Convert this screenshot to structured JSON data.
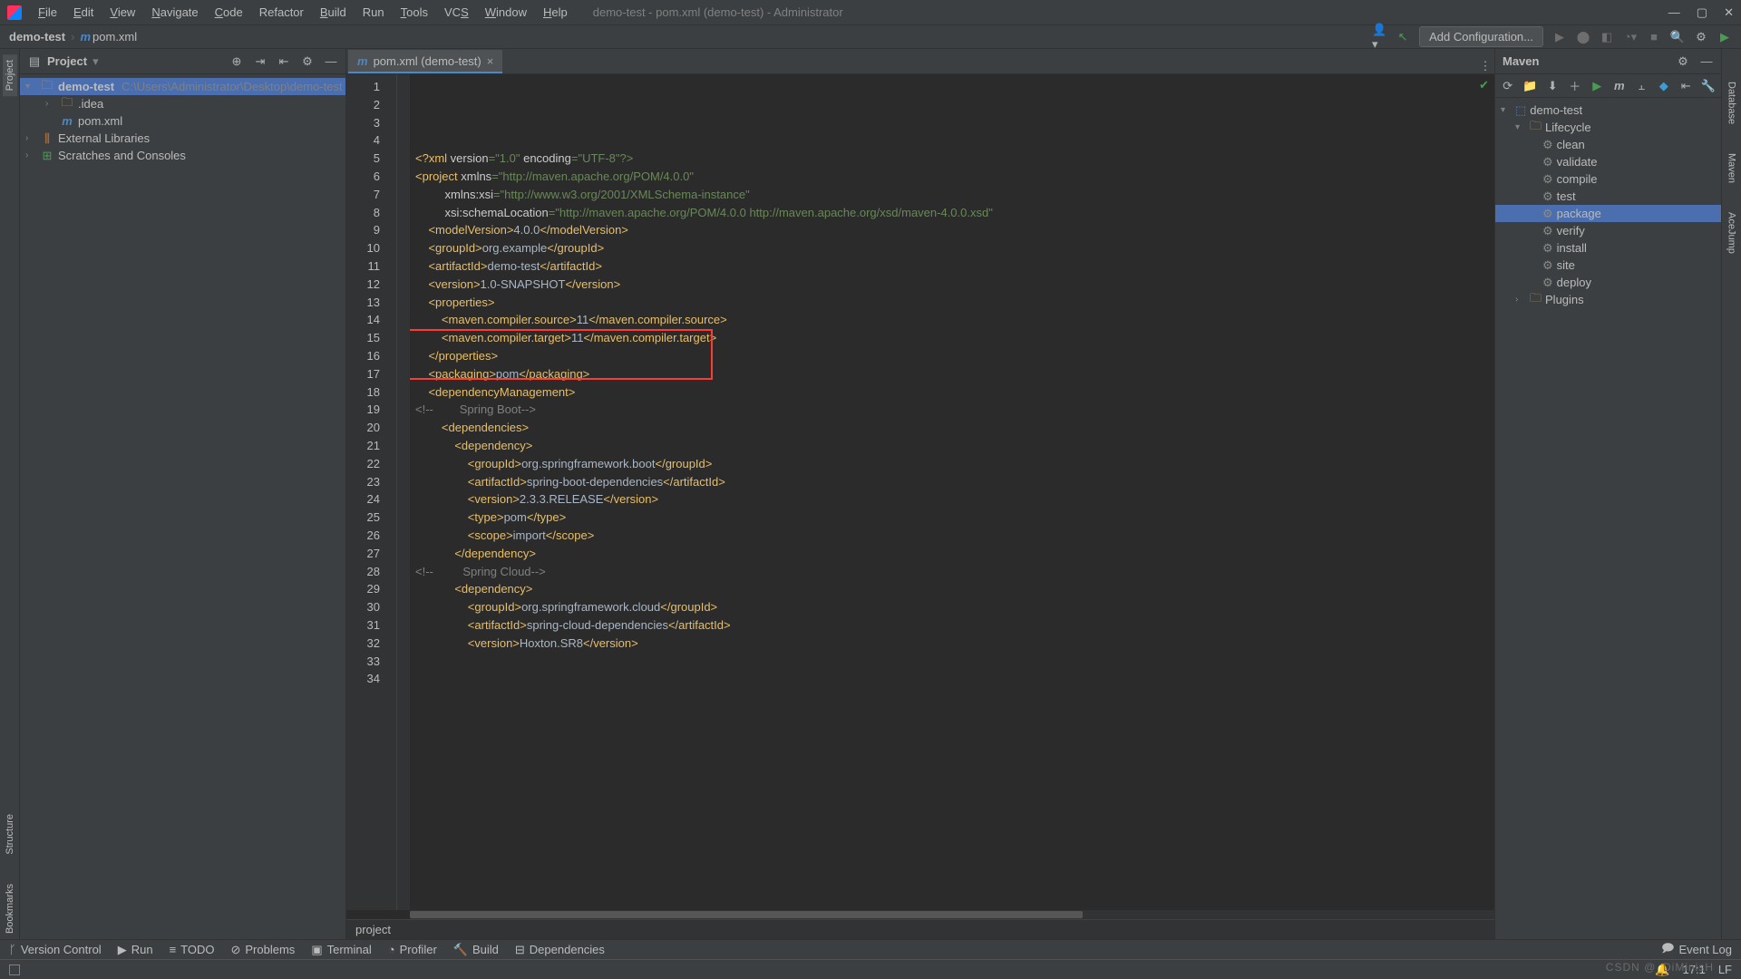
{
  "menu": [
    "File",
    "Edit",
    "View",
    "Navigate",
    "Code",
    "Refactor",
    "Build",
    "Run",
    "Tools",
    "VCS",
    "Window",
    "Help"
  ],
  "menuUnderline": [
    0,
    0,
    0,
    0,
    0,
    -1,
    0,
    -1,
    0,
    2,
    0,
    0
  ],
  "windowTitle": "demo-test - pom.xml (demo-test) - Administrator",
  "breadcrumb": {
    "project": "demo-test",
    "file": "pom.xml"
  },
  "addConfig": "Add Configuration...",
  "leftTabs": [
    "Project",
    "Structure",
    "Bookmarks"
  ],
  "rightTabs": [
    "Database",
    "Maven",
    "AceJump"
  ],
  "projectPanel": {
    "title": "Project"
  },
  "tree": {
    "root": {
      "name": "demo-test",
      "path": "C:\\Users\\Administrator\\Desktop\\demo-test"
    },
    "idea": ".idea",
    "pom": "pom.xml",
    "ext": "External Libraries",
    "scratch": "Scratches and Consoles"
  },
  "tab": {
    "label": "pom.xml (demo-test)"
  },
  "mavenPanel": "Maven",
  "maven": {
    "root": "demo-test",
    "lifecycle": "Lifecycle",
    "goals": [
      "clean",
      "validate",
      "compile",
      "test",
      "package",
      "verify",
      "install",
      "site",
      "deploy"
    ],
    "plugins": "Plugins",
    "selected": "package"
  },
  "code": {
    "lines": 34,
    "l1": {
      "pre": "<?xml ",
      "a1": "version",
      "v1": "=\"1.0\" ",
      "a2": "encoding",
      "v2": "=\"UTF-8\"?>"
    },
    "l2": {
      "t": "<project ",
      "a": "xmlns",
      "s": "=\"http://maven.apache.org/POM/4.0.0\""
    },
    "l3": {
      "a": "xmlns:xsi",
      "s": "=\"http://www.w3.org/2001/XMLSchema-instance\""
    },
    "l4": {
      "a": "xsi:schemaLocation",
      "s": "=\"http://maven.apache.org/POM/4.0.0 http://maven.apache.org/xsd/maven-4.0.0.xsd\""
    },
    "l5": {
      "o": "<modelVersion>",
      "v": "4.0.0",
      "c": "</modelVersion>"
    },
    "l7": {
      "o": "<groupId>",
      "v": "org.example",
      "c": "</groupId>"
    },
    "l8": {
      "o": "<artifactId>",
      "v": "demo-test",
      "c": "</artifactId>"
    },
    "l9": {
      "o": "<version>",
      "v": "1.0-SNAPSHOT",
      "c": "</version>"
    },
    "l11": "<properties>",
    "l12": {
      "o": "<maven.compiler.source>",
      "v": "11",
      "c": "</maven.compiler.source>"
    },
    "l13": {
      "o": "<maven.compiler.target>",
      "v": "11",
      "c": "</maven.compiler.target>"
    },
    "l14": "</properties>",
    "l16": {
      "o": "<packaging>",
      "v": "pom",
      "c": "</packaging>"
    },
    "l18": "<dependencyManagement>",
    "l19": {
      "c1": "<!--",
      "txt": "        Spring Boot",
      "c2": "-->"
    },
    "l20": "<dependencies>",
    "l21": "<dependency>",
    "l22": {
      "o": "<groupId>",
      "v": "org.springframework.boot",
      "c": "</groupId>"
    },
    "l23": {
      "o": "<artifactId>",
      "v": "spring-boot-dependencies",
      "c": "</artifactId>"
    },
    "l24": {
      "o": "<version>",
      "v": "2.3.3.RELEASE",
      "c": "</version>"
    },
    "l25": {
      "o": "<type>",
      "v": "pom",
      "c": "</type>"
    },
    "l26": {
      "o": "<scope>",
      "v": "import",
      "c": "</scope>"
    },
    "l27": "</dependency>",
    "l29": {
      "c1": "<!--",
      "txt": "         Spring Cloud",
      "c2": "-->"
    },
    "l30": "<dependency>",
    "l31": {
      "o": "<groupId>",
      "v": "org.springframework.cloud",
      "c": "</groupId>"
    },
    "l32": {
      "o": "<artifactId>",
      "v": "spring-cloud-dependencies",
      "c": "</artifactId>"
    },
    "l33": {
      "o": "<version>",
      "v": "Hoxton.SR8",
      "c": "</version>"
    }
  },
  "crumbFoot": "project",
  "bottom": {
    "vc": "Version Control",
    "run": "Run",
    "todo": "TODO",
    "prob": "Problems",
    "term": "Terminal",
    "prof": "Profiler",
    "build": "Build",
    "dep": "Dependencies",
    "evt": "Event Log"
  },
  "status": {
    "pos": "17:1",
    "enc": "LF",
    "watermark": "CSDN @_DiMinisH"
  }
}
